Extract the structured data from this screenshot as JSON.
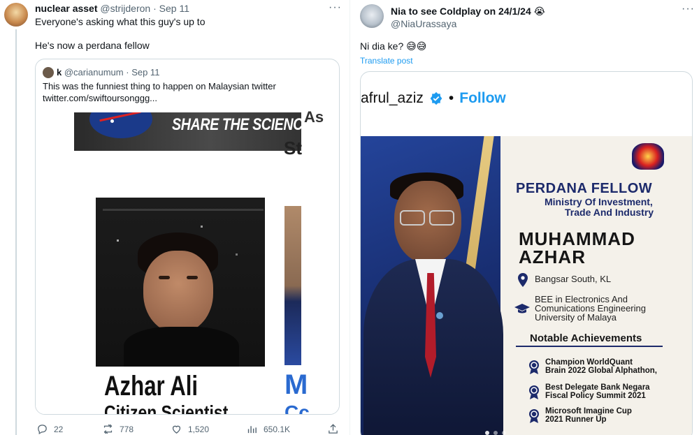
{
  "left_post": {
    "author_name": "nuclear asset",
    "author_handle": "@strijderon",
    "separator": "·",
    "date": "Sep 11",
    "more_icon": "···",
    "text_line1": "Everyone's asking what this guy's up to",
    "text_line2": "He's now a perdana fellow",
    "quote": {
      "author_name": "k",
      "author_handle": "@carianumum",
      "separator": "·",
      "date": "Sep 11",
      "text_line1": "This was the funniest thing to happen on Malaysian twitter",
      "text_line2": "twitter.com/swiftoursonggg...",
      "banner_text": "SHARE THE SCIENCE",
      "side_letters_top": "As",
      "side_letters_bottom": "St",
      "photo_caption_name": "Azhar Ali",
      "photo_caption_role": "Citizen Scientist",
      "side_caption_top": "M",
      "side_caption_bottom": "Cc"
    },
    "stats": {
      "replies": "22",
      "reposts": "778",
      "likes": "1,520",
      "views": "650.1K"
    }
  },
  "right_post": {
    "author_name": "Nia to see Coldplay on 24/1/24",
    "author_emoji": "😭",
    "author_handle": "@NiaUrassaya",
    "more_icon": "···",
    "text": "Ni dia ke? 😅😅",
    "translate": "Translate post",
    "embed": {
      "username": "afrul_aziz",
      "follow_dot": "•",
      "follow": "Follow",
      "poster": {
        "title": "PERDANA FELLOW",
        "ministry_line1": "Ministry Of Investment,",
        "ministry_line2": "Trade And Industry",
        "name_line1": "MUHAMMAD",
        "name_line2": "AZHAR",
        "location": "Bangsar South, KL",
        "edu_line1": "BEE in Electronics And",
        "edu_line2": "Comunications Engineering",
        "edu_line3": "University of Malaya",
        "achievements_heading": "Notable Achievements",
        "achievements": [
          {
            "line1": "Champion WorldQuant",
            "line2": "Brain 2022 Global Alphathon,"
          },
          {
            "line1": "Best Delegate Bank Negara",
            "line2": "Fiscal Policy Summit 2021"
          },
          {
            "line1": "Microsoft Imagine Cup",
            "line2": "2021 Runner Up"
          }
        ]
      }
    }
  },
  "colors": {
    "accent_blue": "#1d9bf0",
    "muted_text": "#536471",
    "border": "#cfd9de",
    "poster_navy": "#1c2a6b",
    "gold": "#c9a450"
  }
}
